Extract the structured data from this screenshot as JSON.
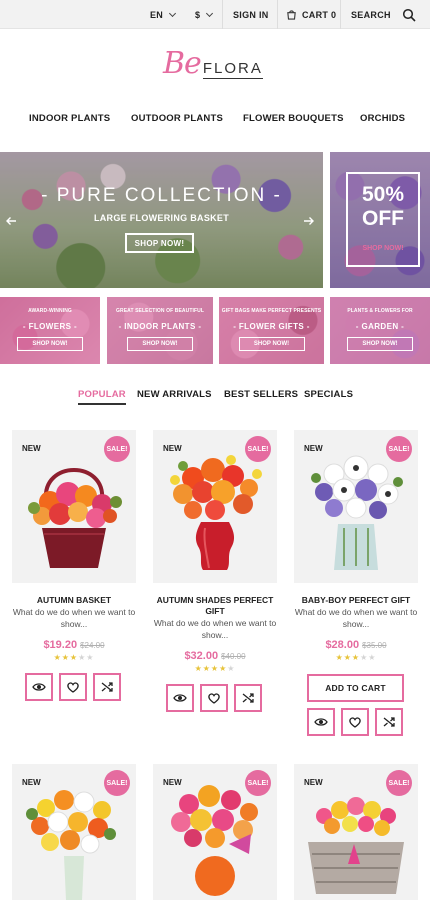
{
  "topbar": {
    "language": "EN",
    "currency": "$",
    "signin": "SIGN IN",
    "cart": "CART 0",
    "search": "SEARCH"
  },
  "logo": {
    "be": "Be",
    "flora": "FLORA"
  },
  "nav": [
    "INDOOR PLANTS",
    "OUTDOOR PLANTS",
    "FLOWER BOUQUETS",
    "ORCHIDS"
  ],
  "hero": {
    "title": "- PURE COLLECTION -",
    "subtitle": "LARGE FLOWERING BASKET",
    "button": "SHOP NOW!"
  },
  "promo": {
    "percent": "50%",
    "off": "OFF",
    "link": "SHOP NOW!"
  },
  "categories": [
    {
      "small": "AWARD-WINNING",
      "title": "- FLOWERS -",
      "button": "SHOP NOW!"
    },
    {
      "small": "GREAT SELECTION OF BEAUTIFUL",
      "title": "- INDOOR PLANTS -",
      "button": "SHOP NOW!"
    },
    {
      "small": "GIFT BAGS MAKE PERFECT PRESENTS",
      "title": "- FLOWER GIFTS -",
      "button": "SHOP NOW!"
    },
    {
      "small": "PLANTS & FLOWERS FOR",
      "title": "- GARDEN -",
      "button": "SHOP NOW!"
    }
  ],
  "tabs": [
    "POPULAR",
    "NEW ARRIVALS",
    "BEST SELLERS",
    "SPECIALS"
  ],
  "products": [
    {
      "badge_new": "NEW",
      "badge_sale": "SALE!",
      "name": "AUTUMN BASKET",
      "desc": "What do we do when we want to show...",
      "price": "$19.20",
      "old_price": "$24.00",
      "rating": 3
    },
    {
      "badge_new": "NEW",
      "badge_sale": "SALE!",
      "name": "AUTUMN SHADES PERFECT GIFT",
      "desc": "What do we do when we want to show...",
      "price": "$32.00",
      "old_price": "$40.00",
      "rating": 4
    },
    {
      "badge_new": "NEW",
      "badge_sale": "SALE!",
      "name": "BABY-BOY PERFECT GIFT",
      "desc": "What do we do when we want to show...",
      "price": "$28.00",
      "old_price": "$35.00",
      "rating": 3,
      "add_to_cart": "ADD TO CART"
    },
    {
      "badge_new": "NEW",
      "badge_sale": "SALE!"
    },
    {
      "badge_new": "NEW",
      "badge_sale": "SALE!"
    },
    {
      "badge_new": "NEW",
      "badge_sale": "SALE!"
    }
  ],
  "colors": {
    "accent": "#e56b9f",
    "star": "#e7c33a",
    "topbar": "#f2f2f2"
  }
}
